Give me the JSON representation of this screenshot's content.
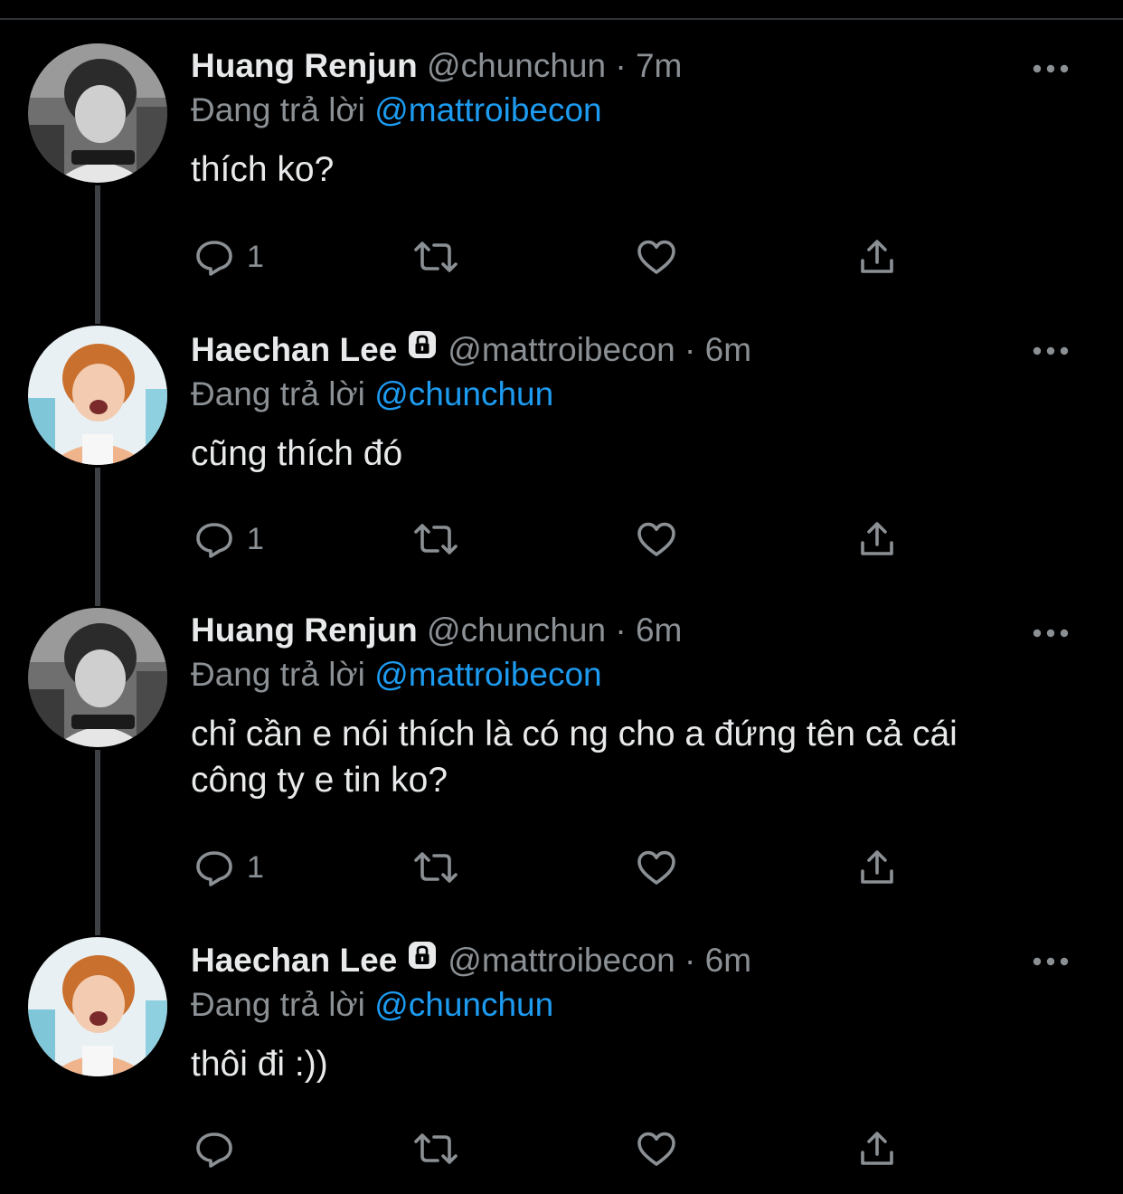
{
  "colors": {
    "background": "#000000",
    "name_text": "#e7e9ea",
    "muted_text": "#8b9095",
    "mention": "#1d9bf0",
    "thread_line": "#3d4145"
  },
  "icons": {
    "reply": "reply-icon",
    "retweet": "retweet-icon",
    "like": "heart-icon",
    "share": "share-icon",
    "more": "more-options-icon",
    "protected": "lock-icon"
  },
  "tweets": [
    {
      "name": "Huang Renjun",
      "handle": "@chunchun",
      "separator": "·",
      "time": "7m",
      "replying_prefix": "Đang trả lời",
      "replying_to": "@mattroibecon",
      "text": "thích ko?",
      "reply_count": "1",
      "protected": false
    },
    {
      "name": "Haechan Lee",
      "handle": "@mattroibecon",
      "separator": "·",
      "time": "6m",
      "replying_prefix": "Đang trả lời",
      "replying_to": "@chunchun",
      "text": "cũng thích đó",
      "reply_count": "1",
      "protected": true
    },
    {
      "name": "Huang Renjun",
      "handle": "@chunchun",
      "separator": "·",
      "time": "6m",
      "replying_prefix": "Đang trả lời",
      "replying_to": "@mattroibecon",
      "text": "chỉ cần e nói thích là có ng cho a đứng tên cả cái công ty e tin ko?",
      "reply_count": "1",
      "protected": false
    },
    {
      "name": "Haechan Lee",
      "handle": "@mattroibecon",
      "separator": "·",
      "time": "6m",
      "replying_prefix": "Đang trả lời",
      "replying_to": "@chunchun",
      "text": "thôi đi :))",
      "reply_count": "",
      "protected": true
    }
  ]
}
